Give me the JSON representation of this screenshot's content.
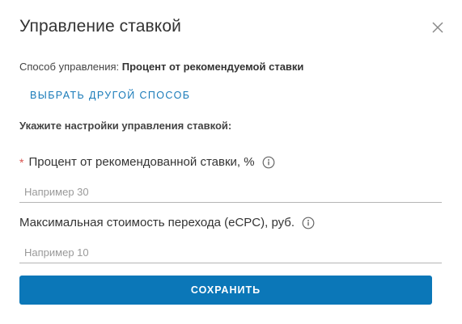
{
  "dialog": {
    "title": "Управление ставкой",
    "close_icon": "close-icon"
  },
  "method": {
    "label": "Способ управления:",
    "value": "Процент от рекомендуемой ставки",
    "change_link": "ВЫБРАТЬ ДРУГОЙ СПОСОБ"
  },
  "settings": {
    "heading": "Укажите настройки управления ставкой:",
    "fields": [
      {
        "required_mark": "*",
        "label": "Процент от рекомендованной ставки, %",
        "placeholder": "Например 30",
        "value": "",
        "icon": "info-icon"
      },
      {
        "label": "Максимальная стоимость перехода (eCPC), руб.",
        "placeholder": "Например 10",
        "value": "",
        "icon": "info-icon"
      }
    ]
  },
  "actions": {
    "save_label": "СОХРАНИТЬ"
  },
  "colors": {
    "accent": "#0b77b8",
    "link": "#1a7bb9",
    "required": "#d9534f"
  }
}
